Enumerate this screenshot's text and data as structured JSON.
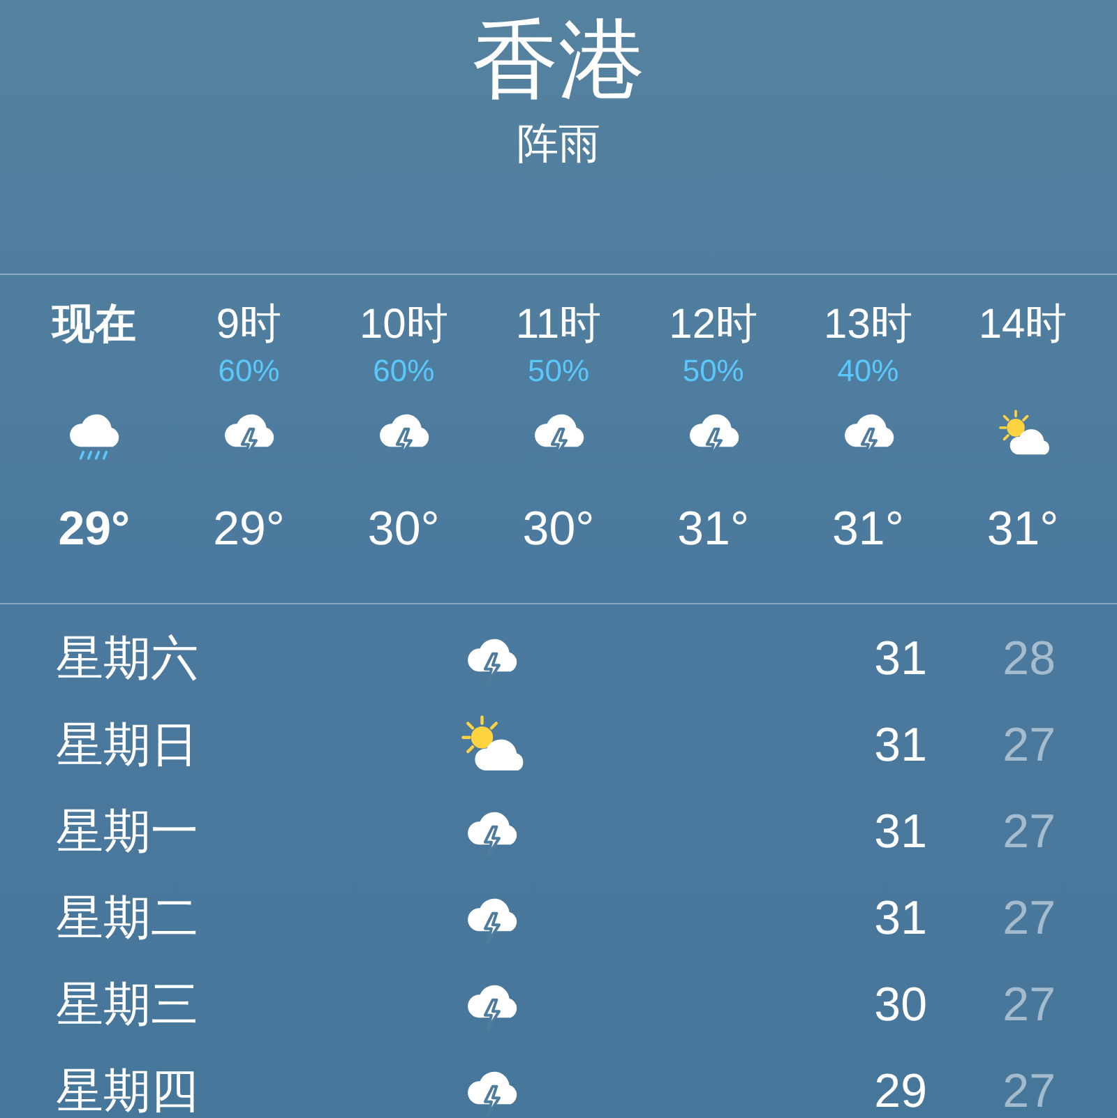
{
  "location": {
    "city": "香港",
    "condition": "阵雨"
  },
  "hourly": [
    {
      "label": "现在",
      "now": true,
      "kind": "rain",
      "temp": "29°"
    },
    {
      "label": "9时",
      "now": false,
      "precip": "60%",
      "kind": "thunder",
      "temp": "29°"
    },
    {
      "label": "10时",
      "now": false,
      "precip": "60%",
      "kind": "thunder",
      "temp": "30°"
    },
    {
      "label": "11时",
      "now": false,
      "precip": "50%",
      "kind": "thunder",
      "temp": "30°"
    },
    {
      "label": "12时",
      "now": false,
      "precip": "50%",
      "kind": "thunder",
      "temp": "31°"
    },
    {
      "label": "13时",
      "now": false,
      "precip": "40%",
      "kind": "thunder",
      "temp": "31°"
    },
    {
      "label": "14时",
      "now": false,
      "kind": "partly-sunny",
      "temp": "31°"
    }
  ],
  "daily": [
    {
      "day": "星期六",
      "kind": "thunder",
      "high": "31",
      "low": "28"
    },
    {
      "day": "星期日",
      "kind": "partly-sunny",
      "high": "31",
      "low": "27"
    },
    {
      "day": "星期一",
      "kind": "thunder",
      "high": "31",
      "low": "27"
    },
    {
      "day": "星期二",
      "kind": "thunder",
      "high": "31",
      "low": "27"
    },
    {
      "day": "星期三",
      "kind": "thunder",
      "high": "30",
      "low": "27"
    },
    {
      "day": "星期四",
      "kind": "thunder",
      "high": "29",
      "low": "27"
    }
  ]
}
